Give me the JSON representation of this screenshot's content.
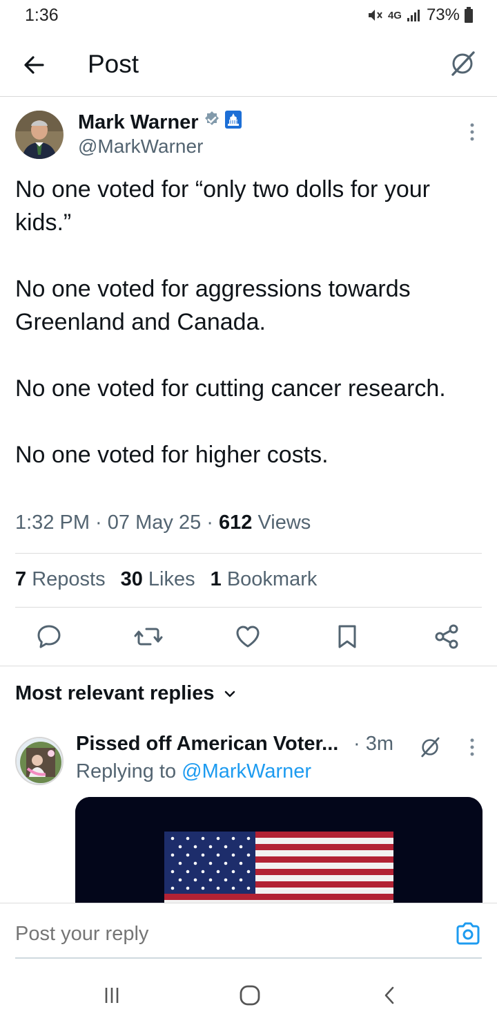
{
  "status_bar": {
    "time": "1:36",
    "network": "4G",
    "battery": "73%"
  },
  "header": {
    "title": "Post"
  },
  "post": {
    "author_name": "Mark Warner",
    "author_handle": "@MarkWarner",
    "text": "No one voted for “only two dolls for your kids.”\n\nNo one voted for aggressions towards Greenland and Canada.\n\nNo one voted for cutting cancer research.\n\nNo one voted for higher costs.",
    "time": "1:32 PM",
    "date": "07 May 25",
    "views_count": "612",
    "views_label": "Views",
    "reposts_count": "7",
    "reposts_label": "Reposts",
    "likes_count": "30",
    "likes_label": "Likes",
    "bookmarks_count": "1",
    "bookmarks_label": "Bookmark"
  },
  "replies": {
    "filter_label": "Most relevant replies",
    "items": [
      {
        "author_name": "Pissed off American Voter...",
        "time": "3m",
        "replying_to_label": "Replying to",
        "replying_to_handle": "@MarkWarner"
      }
    ]
  },
  "composer": {
    "placeholder": "Post your reply"
  },
  "colors": {
    "accent": "#1d9bf0",
    "verified_badge": "#829aab",
    "text_primary": "#0f1419",
    "text_secondary": "#536471"
  }
}
